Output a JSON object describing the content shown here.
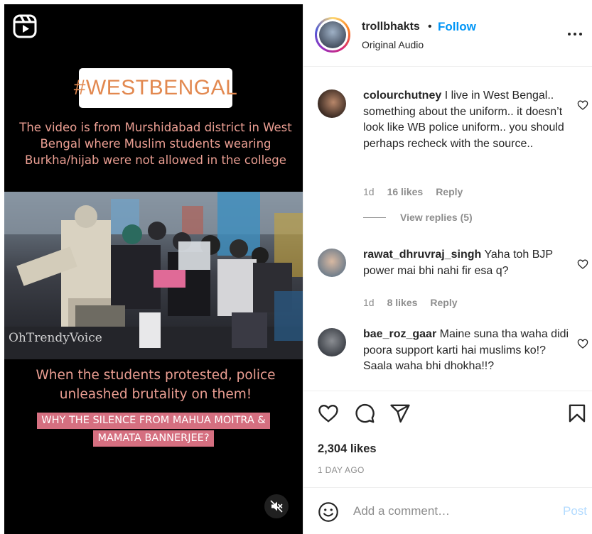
{
  "video": {
    "hashtag": "#WESTBENGAL",
    "caption_top": "The video is from Murshidabad district in West Bengal where Muslim students wearing Burkha/hijab were not allowed in the college",
    "watermark": "OhTrendyVoice",
    "caption_mid": "When the students protested, police unleashed brutality on them!",
    "caption_pink_lines": [
      "WHY THE SILENCE FROM MAHUA MOITRA &",
      "MAMATA BANNERJEE?"
    ],
    "icons": {
      "reels": "reels-icon",
      "mute": "muted-speaker-icon"
    }
  },
  "header": {
    "username": "trollbhakts",
    "separator": "•",
    "follow_label": "Follow",
    "audio": "Original Audio",
    "more_icon": "more-options-icon"
  },
  "comments": [
    {
      "username": "colourchutney",
      "text": "I live in West Bengal.. something about the uniform.. it doesn’t look like WB police uniform.. you should perhaps recheck with the source..",
      "time": "1d",
      "likes": "16 likes",
      "reply_label": "Reply",
      "view_replies": "View replies (5)"
    },
    {
      "username": "rawat_dhruvraj_singh",
      "text": "Yaha toh BJP power mai bhi nahi fir esa q?",
      "time": "1d",
      "likes": "8 likes",
      "reply_label": "Reply"
    },
    {
      "username": "bae_roz_gaar",
      "text": "Maine suna tha waha didi poora support karti hai muslims ko!? Saala waha bhi dhokha!!?"
    }
  ],
  "actions": {
    "like_icon": "heart-icon",
    "comment_icon": "comment-icon",
    "share_icon": "share-icon",
    "save_icon": "bookmark-icon",
    "likes_count": "2,304 likes",
    "posted": "1 DAY AGO"
  },
  "add_comment": {
    "placeholder": "Add a comment…",
    "post_label": "Post",
    "emoji_icon": "emoji-icon"
  },
  "colors": {
    "accent": "#0095f6",
    "post_disabled": "#b3dbff",
    "caption_text": "#ec9f93",
    "hashtag": "#e2884f",
    "pink_box": "#d56f80",
    "muted": "#8e8e8e"
  }
}
